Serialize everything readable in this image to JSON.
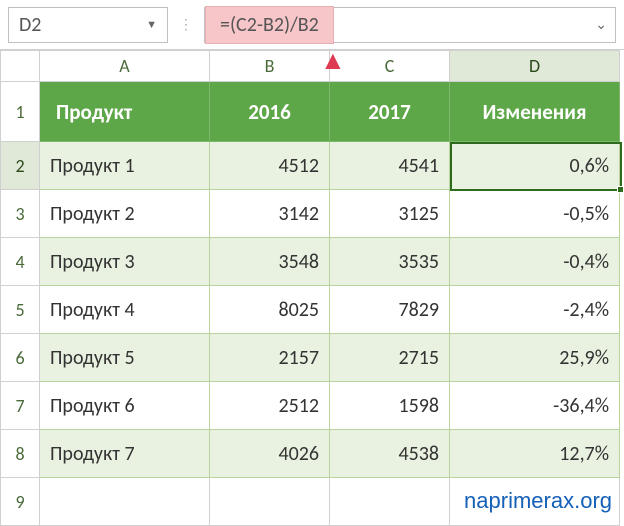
{
  "nameBox": "D2",
  "formula": "=(C2-B2)/B2",
  "columns": [
    "A",
    "B",
    "C",
    "D"
  ],
  "activeCol": "D",
  "activeRow": 2,
  "headers": {
    "A": "Продукт",
    "B": "2016",
    "C": "2017",
    "D": "Изменения"
  },
  "rows": [
    {
      "n": 2,
      "A": "Продукт 1",
      "B": "4512",
      "C": "4541",
      "D": "0,6%"
    },
    {
      "n": 3,
      "A": "Продукт 2",
      "B": "3142",
      "C": "3125",
      "D": "-0,5%"
    },
    {
      "n": 4,
      "A": "Продукт 3",
      "B": "3548",
      "C": "3535",
      "D": "-0,4%"
    },
    {
      "n": 5,
      "A": "Продукт 4",
      "B": "8025",
      "C": "7829",
      "D": "-2,4%"
    },
    {
      "n": 6,
      "A": "Продукт 5",
      "B": "2157",
      "C": "2715",
      "D": "25,9%"
    },
    {
      "n": 7,
      "A": "Продукт 6",
      "B": "2512",
      "C": "1598",
      "D": "-36,4%"
    },
    {
      "n": 8,
      "A": "Продукт 7",
      "B": "4026",
      "C": "4538",
      "D": "12,7%"
    }
  ],
  "emptyRow": 9,
  "watermark": "naprimerax.org",
  "chart_data": {
    "type": "table",
    "title": "",
    "columns": [
      "Продукт",
      "2016",
      "2017",
      "Изменения"
    ],
    "data": [
      [
        "Продукт 1",
        4512,
        4541,
        0.006
      ],
      [
        "Продукт 2",
        3142,
        3125,
        -0.005
      ],
      [
        "Продукт 3",
        3548,
        3535,
        -0.004
      ],
      [
        "Продукт 4",
        8025,
        7829,
        -0.024
      ],
      [
        "Продукт 5",
        2157,
        2715,
        0.259
      ],
      [
        "Продукт 6",
        2512,
        1598,
        -0.364
      ],
      [
        "Продукт 7",
        4026,
        4538,
        0.127
      ]
    ]
  }
}
